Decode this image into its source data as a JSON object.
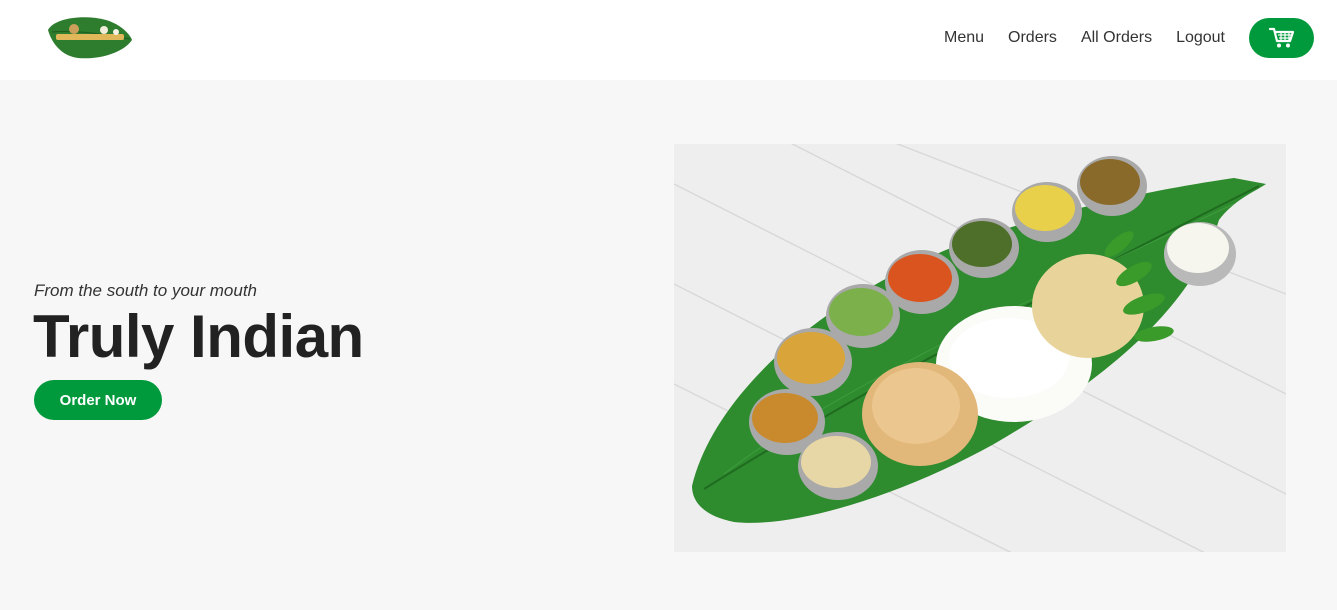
{
  "nav": {
    "logo_icon": "banana-leaf-logo-icon",
    "links": [
      "Menu",
      "Orders",
      "All Orders",
      "Logout"
    ],
    "cart_icon": "shopping-cart-icon"
  },
  "hero": {
    "tagline": "From the south to your mouth",
    "headline": "Truly Indian",
    "cta_label": "Order Now",
    "image_subject": "south-indian-thali-on-banana-leaf"
  },
  "colors": {
    "accent": "#009a3c",
    "page_bg": "#f7f7f7",
    "navbar_bg": "#ffffff",
    "text": "#222222"
  }
}
